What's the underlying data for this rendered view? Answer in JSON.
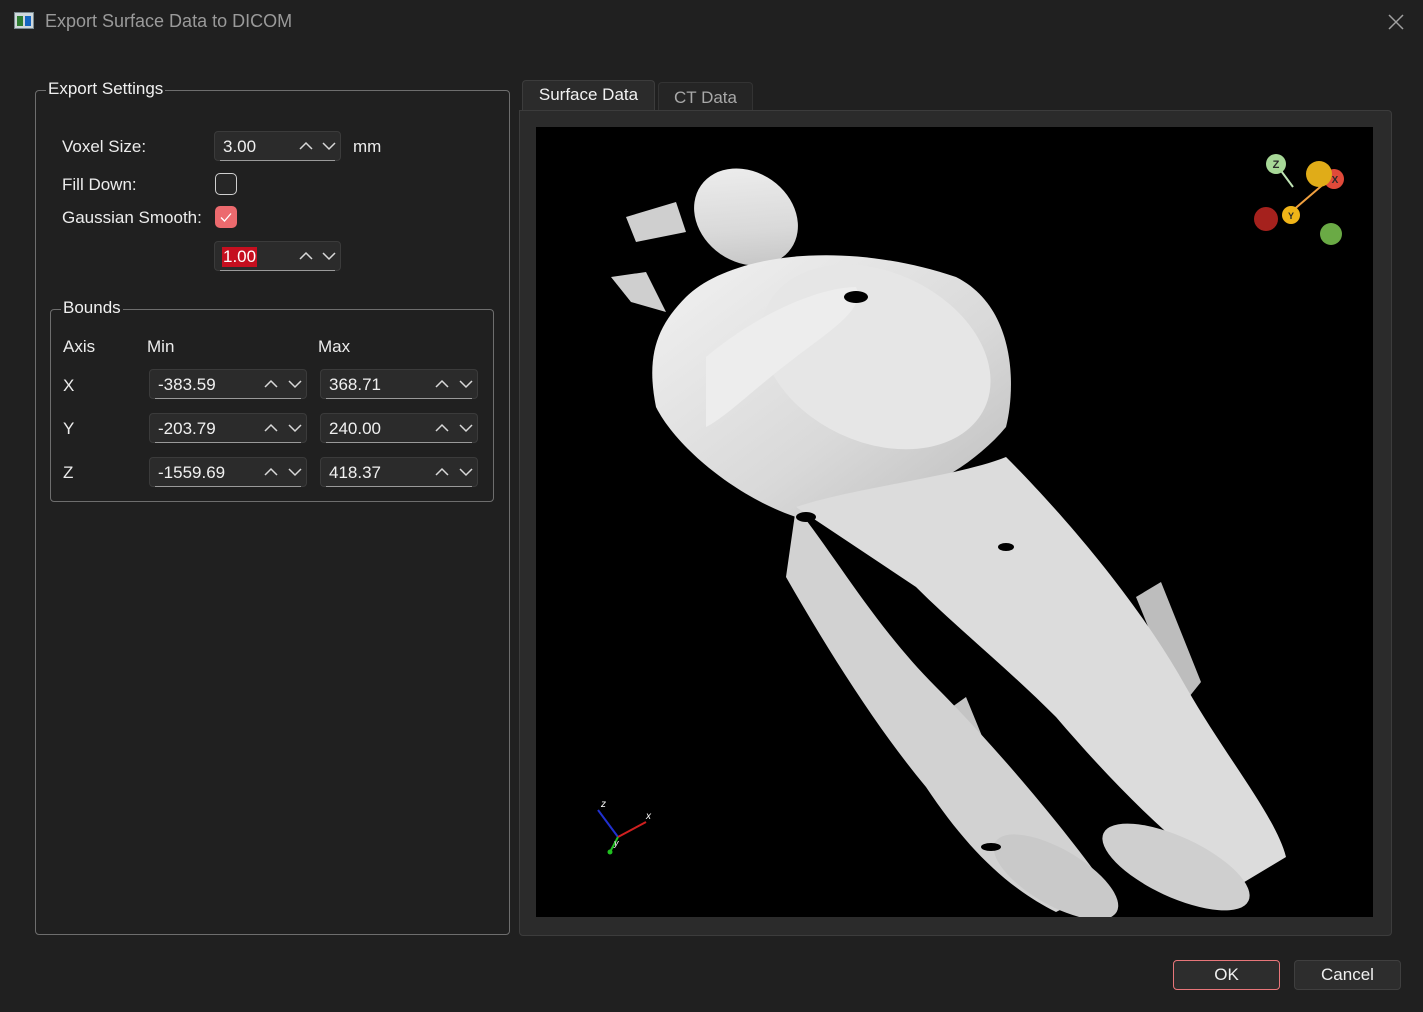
{
  "window": {
    "title": "Export Surface Data to DICOM"
  },
  "export_settings": {
    "group_title": "Export Settings",
    "voxel_size": {
      "label": "Voxel Size:",
      "value": "3.00",
      "unit": "mm"
    },
    "fill_down": {
      "label": "Fill Down:",
      "checked": false
    },
    "gaussian_smooth": {
      "label": "Gaussian Smooth:",
      "checked": true,
      "value": "1.00"
    }
  },
  "bounds": {
    "group_title": "Bounds",
    "headers": {
      "axis": "Axis",
      "min": "Min",
      "max": "Max"
    },
    "rows": [
      {
        "axis": "X",
        "min": "-383.59",
        "max": "368.71"
      },
      {
        "axis": "Y",
        "min": "-203.79",
        "max": "240.00"
      },
      {
        "axis": "Z",
        "min": "-1559.69",
        "max": "418.37"
      }
    ]
  },
  "tabs": [
    {
      "label": "Surface Data",
      "active": true
    },
    {
      "label": "CT Data",
      "active": false
    }
  ],
  "viewport": {
    "orientation_widget": {
      "z_label": "Z",
      "x_label": "X",
      "y_label": "Y"
    },
    "axes_triad": {
      "z_label": "z",
      "x_label": "x",
      "y_label": "y"
    }
  },
  "buttons": {
    "ok": "OK",
    "cancel": "Cancel"
  },
  "colors": {
    "accent": "#ec6a6e",
    "selection": "#c50f1f",
    "background": "#202020"
  }
}
